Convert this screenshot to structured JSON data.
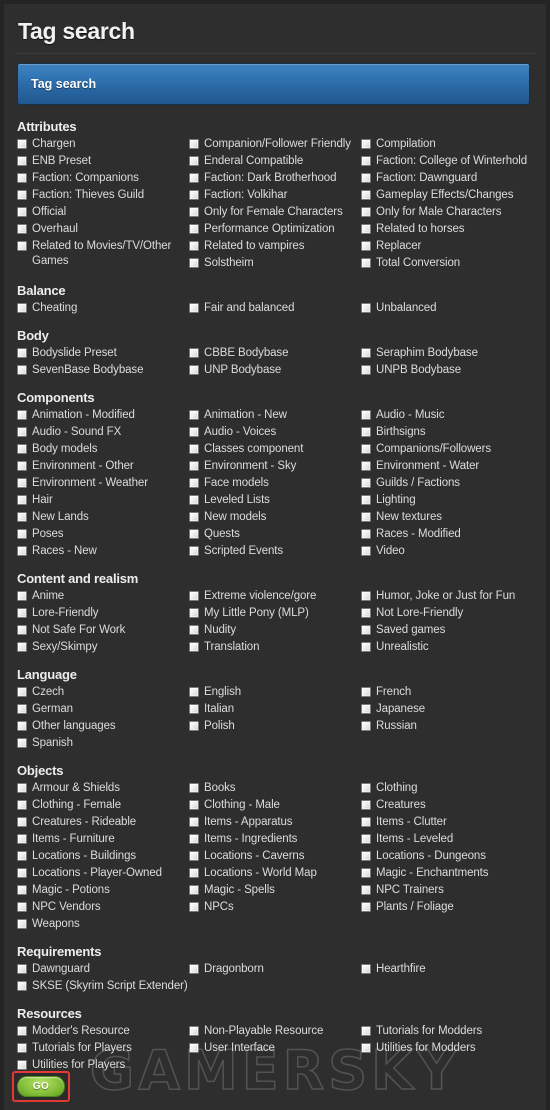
{
  "header": {
    "title": "Tag search"
  },
  "search": {
    "label": "Tag search"
  },
  "watermark": "GAMERSKY",
  "actions": {
    "go_label": "GO"
  },
  "groups": [
    {
      "title": "Attributes",
      "columns": [
        [
          "Chargen",
          "ENB Preset",
          "Faction: Companions",
          "Faction: Thieves Guild",
          "Official",
          "Overhaul",
          "Related to Movies/TV/Other Games"
        ],
        [
          "Companion/Follower Friendly",
          "Enderal Compatible",
          "Faction: Dark Brotherhood",
          "Faction: Volkihar",
          "Only for Female Characters",
          "Performance Optimization",
          "Related to vampires",
          "Solstheim"
        ],
        [
          "Compilation",
          "Faction: College of Winterhold",
          "Faction: Dawnguard",
          "Gameplay Effects/Changes",
          "Only for Male Characters",
          "Related to horses",
          "Replacer",
          "Total Conversion"
        ]
      ]
    },
    {
      "title": "Balance",
      "columns": [
        [
          "Cheating"
        ],
        [
          "Fair and balanced"
        ],
        [
          "Unbalanced"
        ]
      ]
    },
    {
      "title": "Body",
      "columns": [
        [
          "Bodyslide Preset",
          "SevenBase Bodybase"
        ],
        [
          "CBBE Bodybase",
          "UNP Bodybase"
        ],
        [
          "Seraphim Bodybase",
          "UNPB Bodybase"
        ]
      ]
    },
    {
      "title": "Components",
      "columns": [
        [
          "Animation - Modified",
          "Audio - Sound FX",
          "Body models",
          "Environment - Other",
          "Environment - Weather",
          "Hair",
          "New Lands",
          "Poses",
          "Races - New"
        ],
        [
          "Animation - New",
          "Audio - Voices",
          "Classes component",
          "Environment - Sky",
          "Face models",
          "Leveled Lists",
          "New models",
          "Quests",
          "Scripted Events"
        ],
        [
          "Audio - Music",
          "Birthsigns",
          "Companions/Followers",
          "Environment - Water",
          "Guilds / Factions",
          "Lighting",
          "New textures",
          "Races - Modified",
          "Video"
        ]
      ]
    },
    {
      "title": "Content and realism",
      "columns": [
        [
          "Anime",
          "Lore-Friendly",
          "Not Safe For Work",
          "Sexy/Skimpy"
        ],
        [
          "Extreme violence/gore",
          "My Little Pony (MLP)",
          "Nudity",
          "Translation"
        ],
        [
          "Humor, Joke or Just for Fun",
          "Not Lore-Friendly",
          "Saved games",
          "Unrealistic"
        ]
      ]
    },
    {
      "title": "Language",
      "columns": [
        [
          "Czech",
          "German",
          "Other languages",
          "Spanish"
        ],
        [
          "English",
          "Italian",
          "Polish"
        ],
        [
          "French",
          "Japanese",
          "Russian"
        ]
      ]
    },
    {
      "title": "Objects",
      "columns": [
        [
          "Armour & Shields",
          "Clothing - Female",
          "Creatures - Rideable",
          "Items - Furniture",
          "Locations - Buildings",
          "Locations - Player-Owned",
          "Magic - Potions",
          "NPC Vendors",
          "Weapons"
        ],
        [
          "Books",
          "Clothing - Male",
          "Items - Apparatus",
          "Items - Ingredients",
          "Locations - Caverns",
          "Locations - World Map",
          "Magic - Spells",
          "NPCs"
        ],
        [
          "Clothing",
          "Creatures",
          "Items - Clutter",
          "Items - Leveled",
          "Locations - Dungeons",
          "Magic - Enchantments",
          "NPC Trainers",
          "Plants / Foliage"
        ]
      ]
    },
    {
      "title": "Requirements",
      "columns": [
        [
          "Dawnguard",
          "SKSE (Skyrim Script Extender)"
        ],
        [
          "Dragonborn"
        ],
        [
          "Hearthfire"
        ]
      ]
    },
    {
      "title": "Resources",
      "columns": [
        [
          "Modder's Resource",
          "Tutorials for Players",
          "Utilities for Players"
        ],
        [
          "Non-Playable Resource",
          "User Interface"
        ],
        [
          "Tutorials for Modders",
          "Utilities for Modders"
        ]
      ]
    }
  ]
}
